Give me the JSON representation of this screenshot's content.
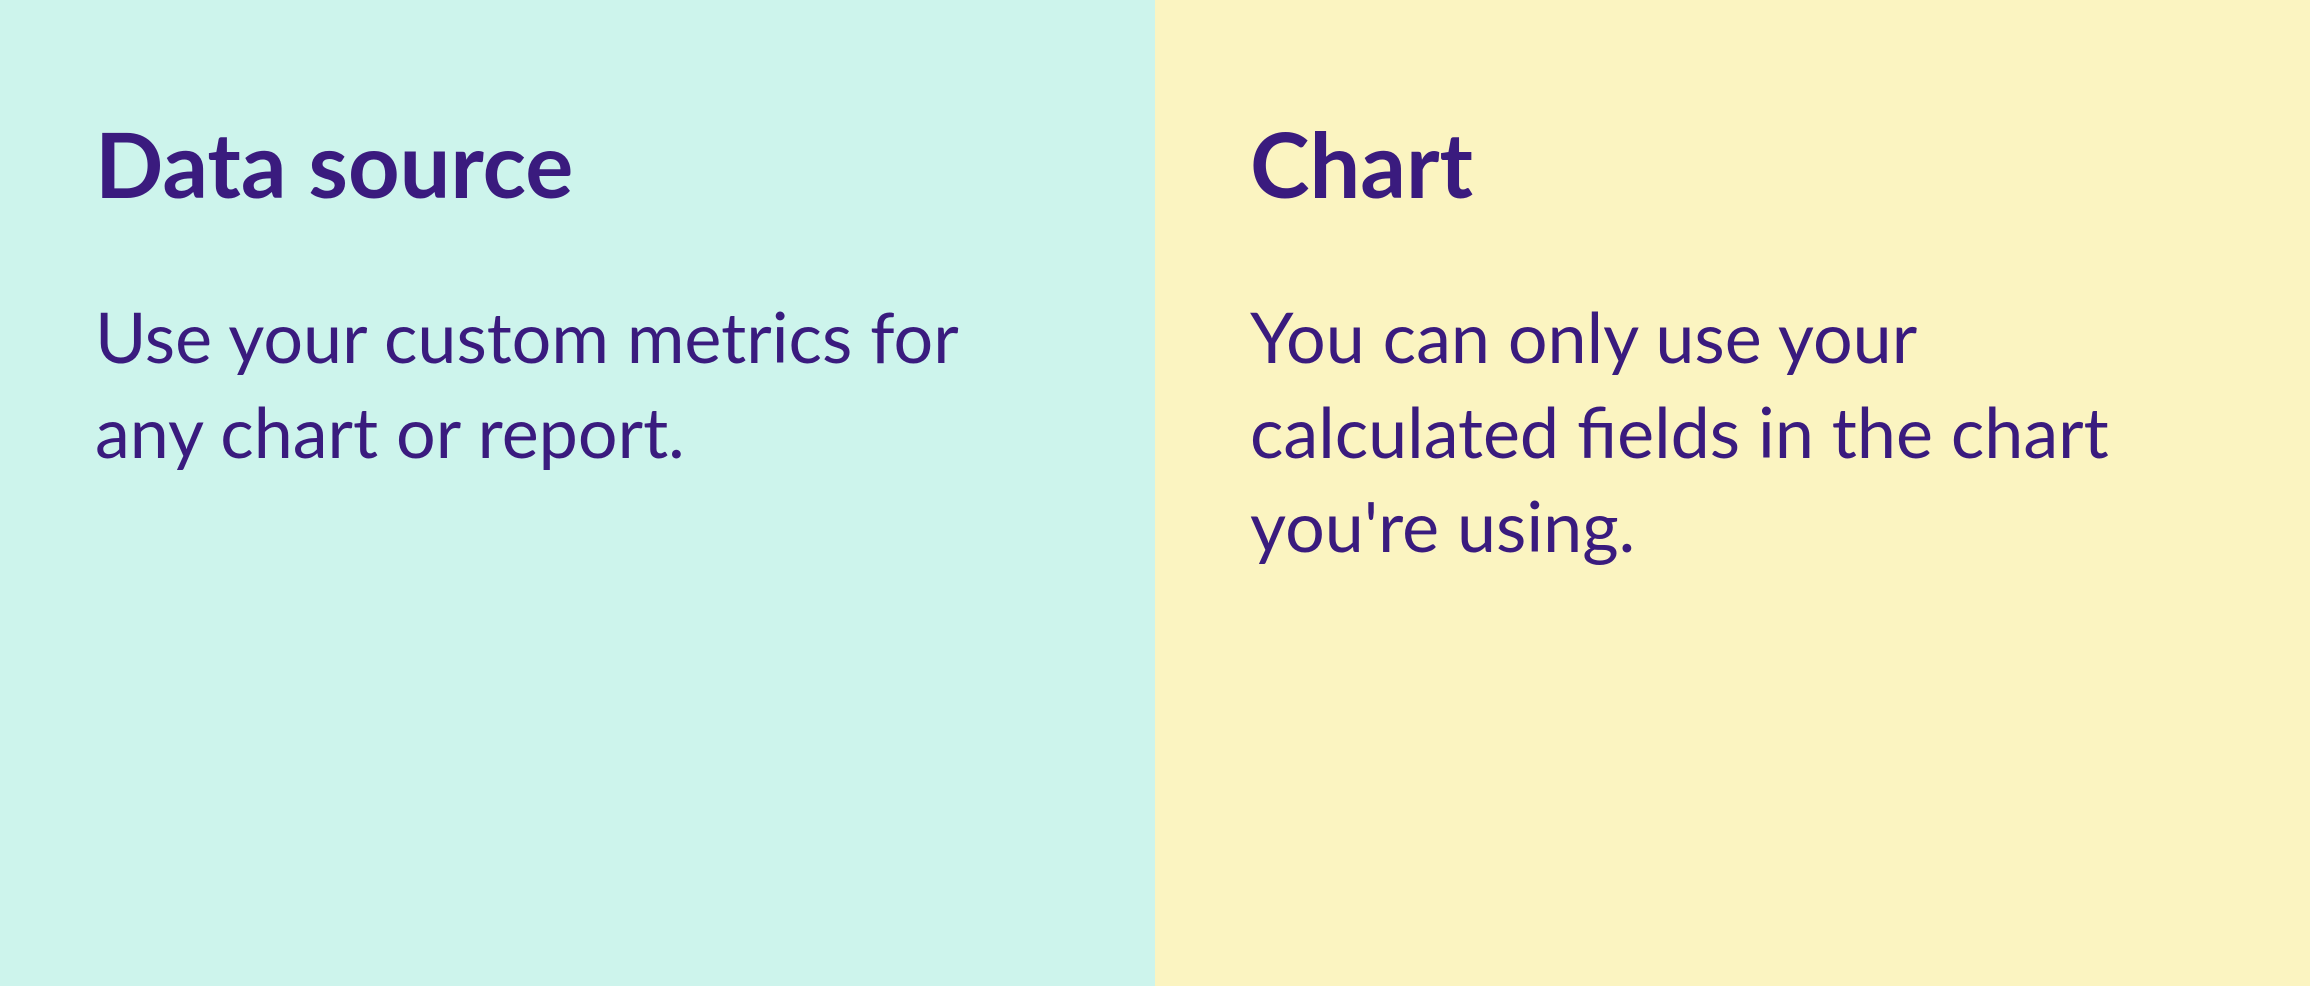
{
  "left": {
    "heading": "Data source",
    "body": "Use your custom metrics for any chart or report."
  },
  "right": {
    "heading": "Chart",
    "body": "You can only use your calculated fields in the chart you're using."
  }
}
